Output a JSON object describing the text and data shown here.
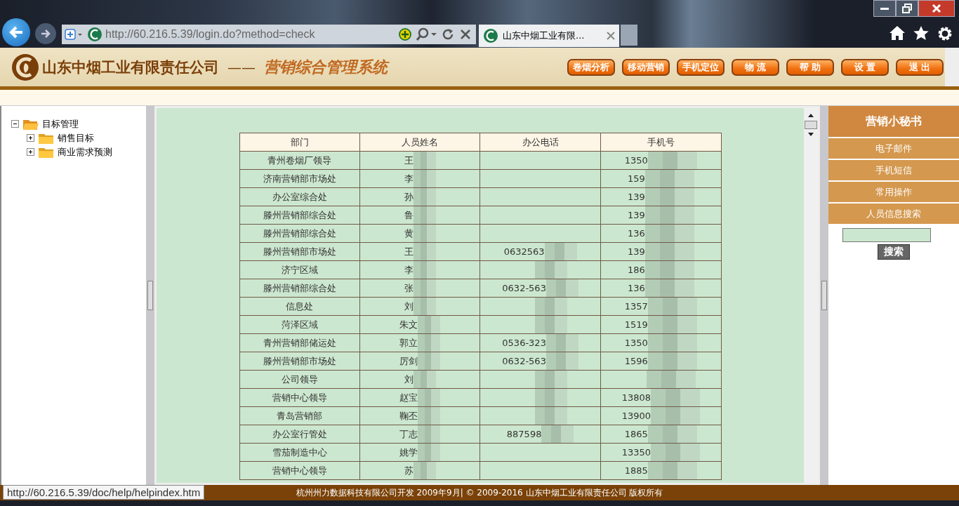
{
  "browser": {
    "url": "http://60.216.5.39/login.do?method=check",
    "tab_title": "山东中烟工业有限..."
  },
  "header": {
    "company": "山东中烟工业有限责任公司",
    "separator": "——",
    "system": "营销综合管理系统",
    "nav_buttons": [
      "卷烟分析",
      "移动营销",
      "手机定位",
      "物 流",
      "帮 助",
      "设 置",
      "退 出"
    ]
  },
  "tree": [
    {
      "label": "目标管理",
      "expanded": true,
      "children": [
        {
          "label": "销售目标",
          "expanded": false
        },
        {
          "label": "商业需求预测",
          "expanded": false
        }
      ]
    }
  ],
  "table": {
    "columns": [
      "部门",
      "人员姓名",
      "办公电话",
      "手机号"
    ],
    "rows": [
      [
        "青州卷烟厂领导",
        "王",
        "",
        "1350"
      ],
      [
        "济南营销部市场处",
        "李",
        "",
        "159"
      ],
      [
        "办公室综合处",
        "孙",
        "",
        "139"
      ],
      [
        "滕州营销部综合处",
        "鲁",
        "",
        "139"
      ],
      [
        "滕州营销部综合处",
        "黄",
        "",
        "136"
      ],
      [
        "滕州营销部市场处",
        "王",
        "0632563",
        "139"
      ],
      [
        "济宁区域",
        "李",
        "",
        "186"
      ],
      [
        "滕州营销部综合处",
        "张",
        "0632-563",
        "136"
      ],
      [
        "信息处",
        "刘",
        "",
        "1357"
      ],
      [
        "菏泽区域",
        "朱文",
        "",
        "1519"
      ],
      [
        "青州营销部储运处",
        "郭立",
        "0536-323",
        "1350"
      ],
      [
        "滕州营销部市场处",
        "厉剑",
        "0632-563",
        "1596"
      ],
      [
        "公司领导",
        "刘",
        "",
        ""
      ],
      [
        "营销中心领导",
        "赵宝",
        "",
        "13808"
      ],
      [
        "青岛营销部",
        "鞠丕",
        "",
        "13900"
      ],
      [
        "办公室行管处",
        "丁志",
        "887598",
        "1865"
      ],
      [
        "雪茄制造中心",
        "姚学",
        "",
        "13350"
      ],
      [
        "营销中心领导",
        "苏",
        "",
        "1885"
      ]
    ]
  },
  "sidebar": {
    "title": "营销小秘书",
    "items": [
      "电子邮件",
      "手机短信",
      "常用操作",
      "人员信息搜索"
    ],
    "search_button": "搜索"
  },
  "footer": "杭州州力数据科技有限公司开发 2009年9月| © 2009-2016 山东中烟工业有限责任公司 版权所有",
  "status_url": "http://60.216.5.39/doc/help/helpindex.htm"
}
